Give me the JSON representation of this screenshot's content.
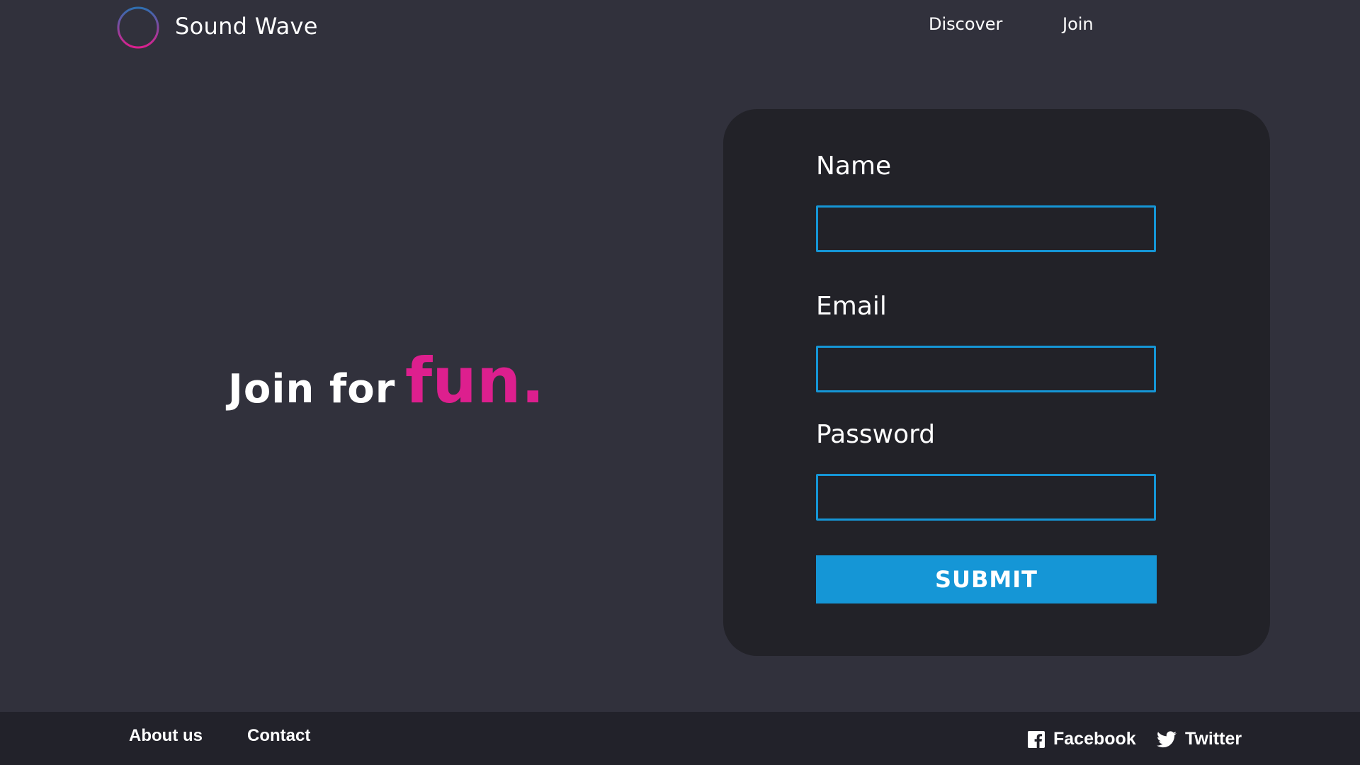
{
  "header": {
    "brand": "Sound Wave",
    "logo_icon": "sound-wave-logo-icon",
    "nav": [
      {
        "label": "Discover"
      },
      {
        "label": "Join"
      }
    ]
  },
  "hero": {
    "text_white": "Join for",
    "text_accent": "fun.",
    "accent_color": "#dd1f8e"
  },
  "form": {
    "fields": [
      {
        "label": "Name",
        "value": ""
      },
      {
        "label": "Email",
        "value": ""
      },
      {
        "label": "Password",
        "value": ""
      }
    ],
    "submit_label": "SUBMIT",
    "accent_color": "#1596d6"
  },
  "footer": {
    "links": [
      {
        "label": "About us"
      },
      {
        "label": "Contact"
      }
    ],
    "social": [
      {
        "label": "Facebook",
        "icon": "facebook-icon"
      },
      {
        "label": "Twitter",
        "icon": "twitter-icon"
      }
    ]
  },
  "colors": {
    "background": "#31313c",
    "card": "#222228",
    "footer": "#22222a"
  }
}
